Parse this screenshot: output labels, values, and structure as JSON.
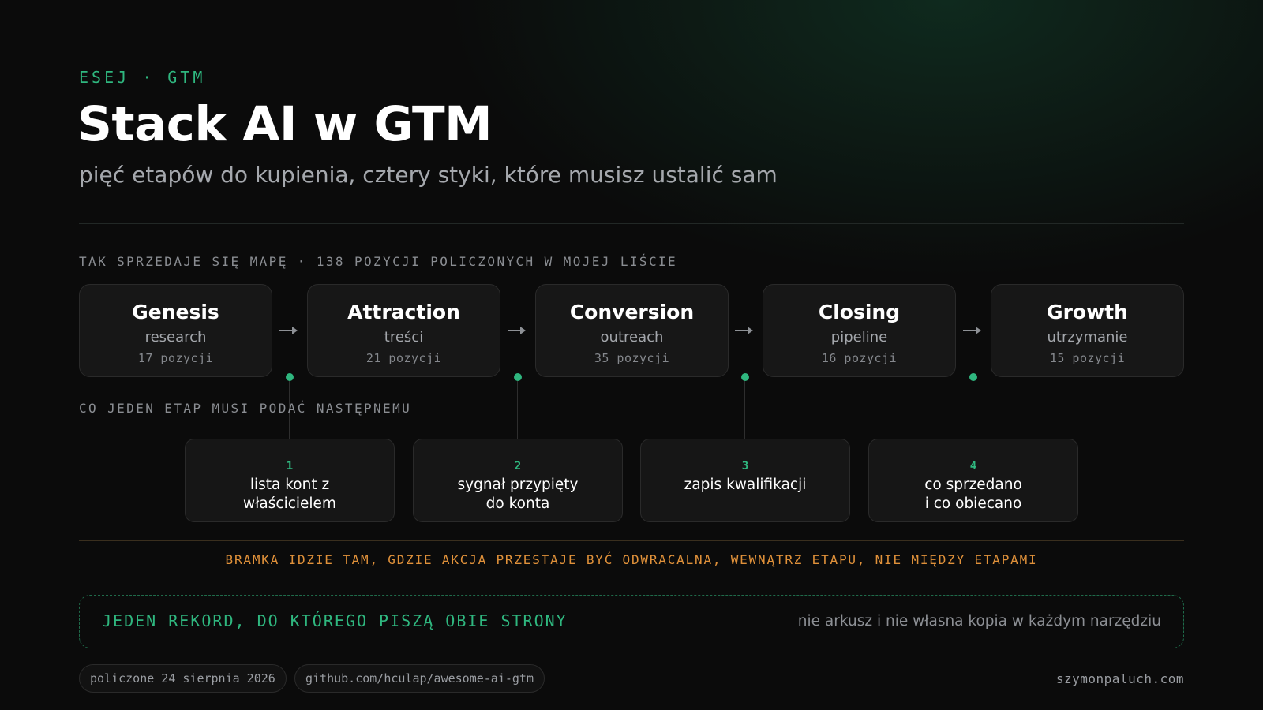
{
  "header": {
    "kicker": "ESEJ · GTM",
    "title": "Stack AI w GTM",
    "subtitle": "pięć etapów do kupienia, cztery styki, które musisz ustalić sam"
  },
  "stages_section": {
    "label": "TAK SPRZEDAJE SIĘ MAPĘ · 138 POZYCJI POLICZONYCH W MOJEJ LIŚCIE",
    "stages": [
      {
        "name": "Genesis",
        "sub": "research",
        "count": "17 pozycji"
      },
      {
        "name": "Attraction",
        "sub": "treści",
        "count": "21 pozycji"
      },
      {
        "name": "Conversion",
        "sub": "outreach",
        "count": "35 pozycji"
      },
      {
        "name": "Closing",
        "sub": "pipeline",
        "count": "16 pozycji"
      },
      {
        "name": "Growth",
        "sub": "utrzymanie",
        "count": "15 pozycji"
      }
    ],
    "arrow_icon": "arrow-right-icon"
  },
  "handoffs_section": {
    "label": "CO JEDEN ETAP MUSI PODAĆ NASTĘPNEMU",
    "handoffs": [
      {
        "num": "1",
        "text": "lista kont z\nwłaścicielem"
      },
      {
        "num": "2",
        "text": "sygnał przypięty\ndo konta"
      },
      {
        "num": "3",
        "text": "zapis kwalifikacji"
      },
      {
        "num": "4",
        "text": "co sprzedano\ni co obiecano"
      }
    ]
  },
  "gate_note": "BRAMKA IDZIE TAM, GDZIE AKCJA PRZESTAJE BYĆ ODWRACALNA, WEWNĄTRZ ETAPU, NIE MIĘDZY ETAPAMI",
  "record": {
    "title": "JEDEN REKORD, DO KTÓREGO PISZĄ OBIE STRONY",
    "note": "nie arkusz i nie własna kopia w każdym narzędziu"
  },
  "footer": {
    "date_pill": "policzone 24 sierpnia 2026",
    "repo_pill": "github.com/hculap/awesome-ai-gtm",
    "site": "szymonpaluch.com"
  },
  "colors": {
    "accent_green": "#2fb77f",
    "accent_amber": "#e0913a",
    "background": "#0b0b0b",
    "card": "#171717"
  }
}
